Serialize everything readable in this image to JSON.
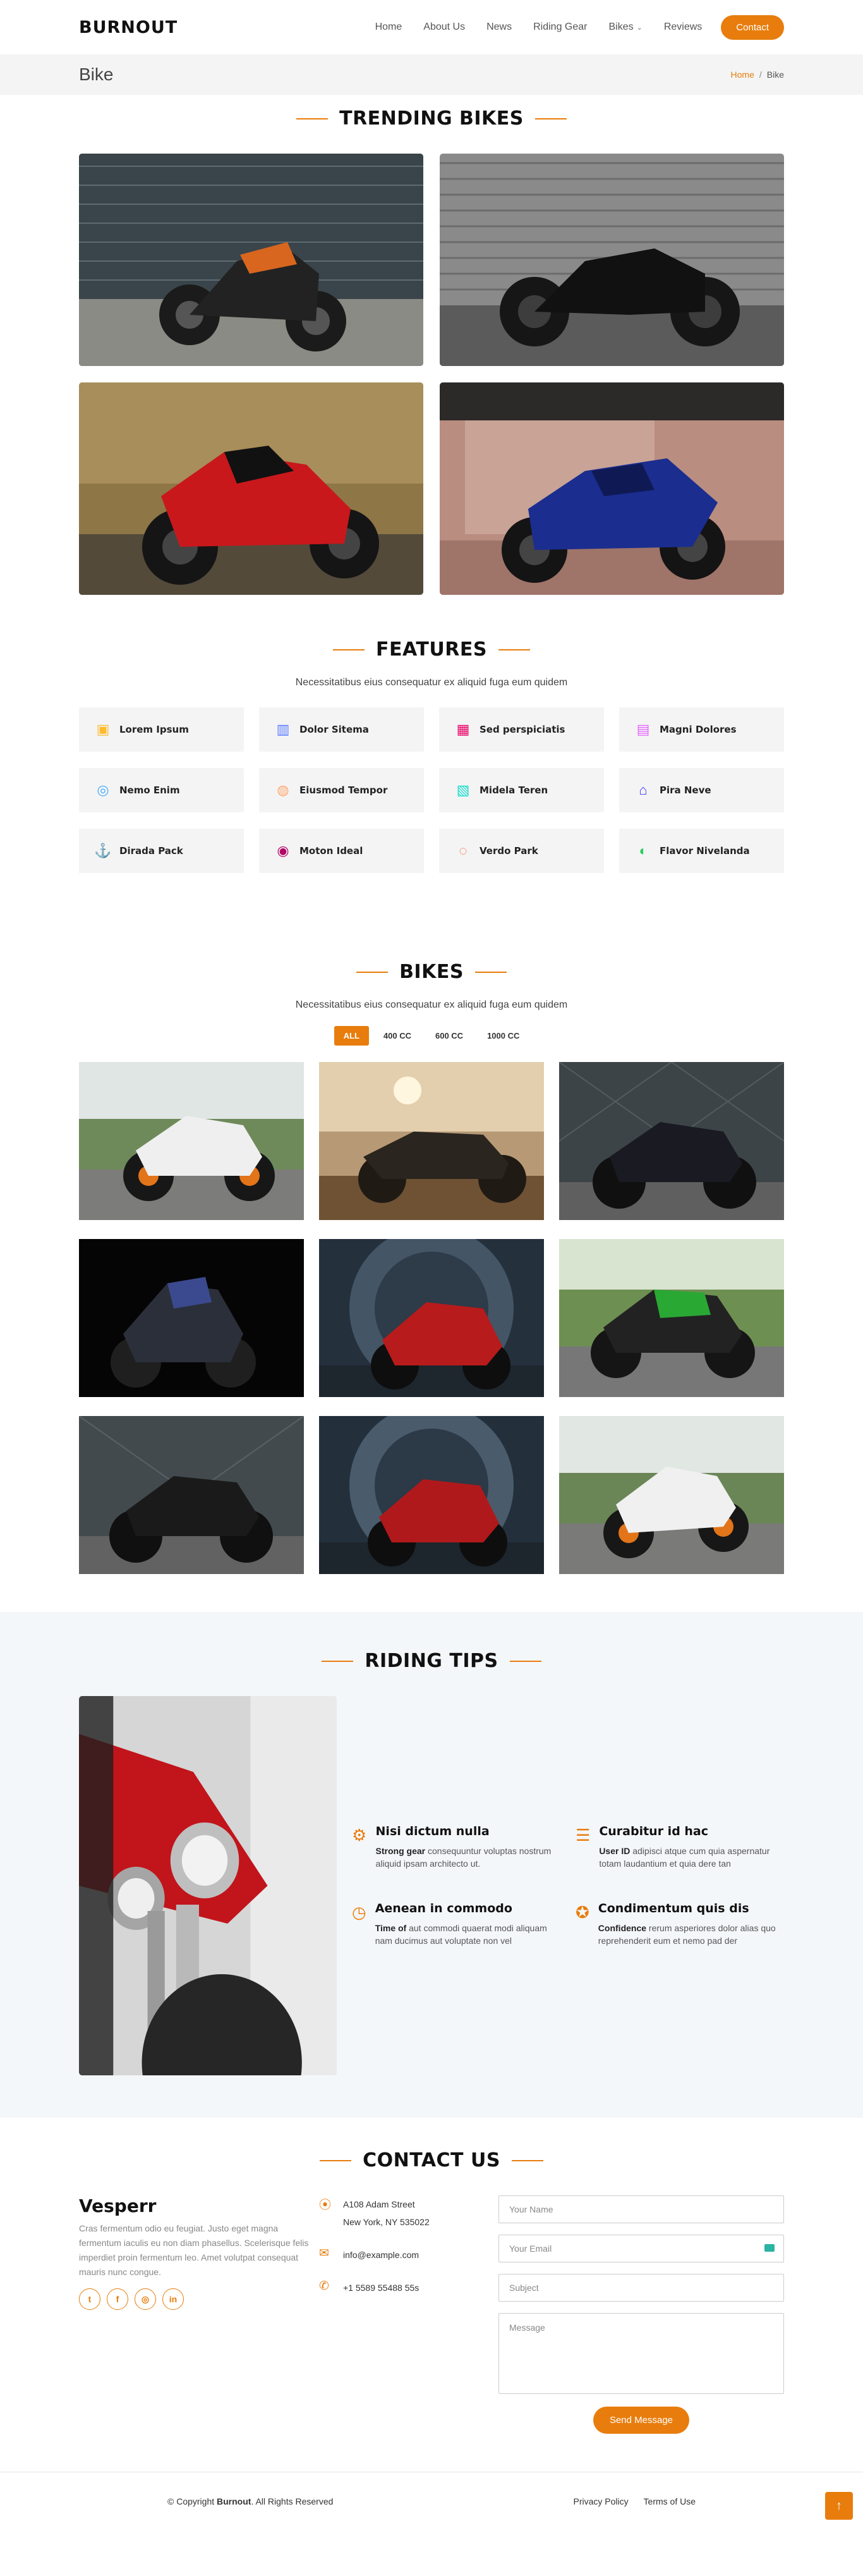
{
  "header": {
    "logo": "BURNOUT",
    "nav": [
      {
        "label": "Home"
      },
      {
        "label": "About Us"
      },
      {
        "label": "News"
      },
      {
        "label": "Riding Gear"
      },
      {
        "label": "Bikes"
      },
      {
        "label": "Reviews"
      }
    ],
    "contact_label": "Contact"
  },
  "breadcrumbs": {
    "title": "Bike",
    "home": "Home",
    "separator": "/",
    "current": "Bike"
  },
  "trending": {
    "title": "TRENDING BIKES"
  },
  "features": {
    "title": "FEATURES",
    "subtitle": "Necessitatibus eius consequatur ex aliquid fuga eum quidem",
    "items": [
      {
        "label": "Lorem Ipsum",
        "icon": "eye-icon",
        "color": "#ffbb2c",
        "glyph": "▣"
      },
      {
        "label": "Dolor Sitema",
        "icon": "chart-icon",
        "color": "#5578ff",
        "glyph": "▥"
      },
      {
        "label": "Sed perspiciatis",
        "icon": "calendar-icon",
        "color": "#e80368",
        "glyph": "▦"
      },
      {
        "label": "Magni Dolores",
        "icon": "paint-icon",
        "color": "#e361ff",
        "glyph": "▤"
      },
      {
        "label": "Nemo Enim",
        "icon": "database-icon",
        "color": "#47aeff",
        "glyph": "◎"
      },
      {
        "label": "Eiusmod Tempor",
        "icon": "gradient-icon",
        "color": "#ffa76e",
        "glyph": "◍"
      },
      {
        "label": "Midela Teren",
        "icon": "file-icon",
        "color": "#11dbcf",
        "glyph": "▧"
      },
      {
        "label": "Pira Neve",
        "icon": "home-icon",
        "color": "#4233ff",
        "glyph": "⌂"
      },
      {
        "label": "Dirada Pack",
        "icon": "anchor-icon",
        "color": "#b2904f",
        "glyph": "⚓"
      },
      {
        "label": "Moton Ideal",
        "icon": "disc-icon",
        "color": "#b20969",
        "glyph": "◉"
      },
      {
        "label": "Verdo Park",
        "icon": "broadcast-icon",
        "color": "#ff5828",
        "glyph": "◌"
      },
      {
        "label": "Flavor Nivelanda",
        "icon": "fingerprint-icon",
        "color": "#29cc61",
        "glyph": "◐"
      }
    ]
  },
  "bikes": {
    "title": "BIKES",
    "subtitle": "Necessitatibus eius consequatur ex aliquid fuga eum quidem",
    "filters": [
      {
        "label": "ALL",
        "active": true
      },
      {
        "label": "400 CC",
        "active": false
      },
      {
        "label": "600 CC",
        "active": false
      },
      {
        "label": "1000 CC",
        "active": false
      }
    ]
  },
  "tips": {
    "title": "RIDING TIPS",
    "items": [
      {
        "icon": "gear-icon",
        "glyph": "⚙",
        "heading": "Nisi dictum nulla",
        "strong": "Strong gear",
        "text": " consequuntur voluptas nostrum aliquid ipsam architecto ut."
      },
      {
        "icon": "clipboard-icon",
        "glyph": "☰",
        "heading": "Curabitur id hac",
        "strong": "User ID",
        "text": " adipisci atque cum quia aspernatur totam laudantium et quia dere tan"
      },
      {
        "icon": "clock-icon",
        "glyph": "◷",
        "heading": "Aenean in commodo",
        "strong": "Time of",
        "text": " aut commodi quaerat modi aliquam nam ducimus aut voluptate non vel"
      },
      {
        "icon": "award-icon",
        "glyph": "✪",
        "heading": "Condimentum quis dis",
        "strong": "Confidence",
        "text": " rerum asperiores dolor alias quo reprehenderit eum et nemo pad der"
      }
    ]
  },
  "contact": {
    "title": "CONTACT US",
    "brand": "Vesperr",
    "about": "Cras fermentum odio eu feugiat. Justo eget magna fermentum iaculis eu non diam phasellus. Scelerisque felis imperdiet proin fermentum leo. Amet volutpat consequat mauris nunc congue.",
    "socials": [
      {
        "icon": "twitter-icon",
        "glyph": "t"
      },
      {
        "icon": "facebook-icon",
        "glyph": "f"
      },
      {
        "icon": "instagram-icon",
        "glyph": "◎"
      },
      {
        "icon": "linkedin-icon",
        "glyph": "in"
      }
    ],
    "address_line1": "A108 Adam Street",
    "address_line2": "New York, NY 535022",
    "email": "info@example.com",
    "phone": "+1 5589 55488 55s",
    "form": {
      "name_placeholder": "Your Name",
      "email_placeholder": "Your Email",
      "subject_placeholder": "Subject",
      "message_placeholder": "Message",
      "send_label": "Send Message"
    }
  },
  "footer": {
    "copyright_prefix": "© Copyright ",
    "copyright_brand": "Burnout",
    "copyright_suffix": ". All Rights Reserved",
    "links": [
      "Privacy Policy",
      "Terms of Use"
    ]
  },
  "colors": {
    "accent": "#e87d0d",
    "light_bg": "#f4f4f4",
    "tips_bg": "#f4f7fa"
  }
}
